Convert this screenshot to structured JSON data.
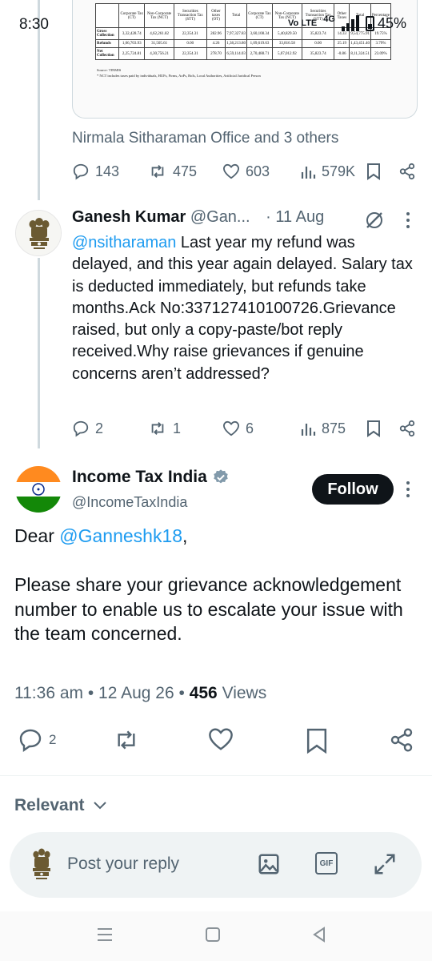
{
  "status_bar": {
    "time": "8:30",
    "network": "4G",
    "volte": "Vo LTE",
    "battery": "45%"
  },
  "media": {
    "table": {
      "headers": [
        "",
        "Corporate Tax (CT)",
        "Non-Corporate Tax (NCT)",
        "Securities Transaction Tax (STT)",
        "Other taxes (OT)",
        "Total",
        "Corporate Tax (CT)",
        "Non-Corporate Tax (NCT)",
        "Securities Transaction Tax (STT)",
        "Other Taxes",
        "Total",
        "Percentage"
      ],
      "rows": [
        [
          "Gross Collection",
          "3,32,428.74",
          "4,62,261.82",
          "22,354.31",
          "282.96",
          "7,97,327.83",
          "3,60,108.34",
          "5,40,829.50",
          "35,823.74",
          "14.33",
          "9,54,775.91",
          "19.75%"
        ],
        [
          "Refunds",
          "1,06,703.93",
          "31,505.61",
          "0.00",
          "4.26",
          "1,38,213.80",
          "1,09,619.63",
          "33,816.58",
          "0.00",
          "25.19",
          "1,43,451.40",
          "3.79%"
        ],
        [
          "Net Collection",
          "2,25,724.81",
          "4,30,756.21",
          "22,354.31",
          "278.70",
          "6,59,114.03",
          "2,70,488.71",
          "5,07,012.92",
          "35,823.74",
          "-0.86",
          "8,11,324.51",
          "23.09%"
        ]
      ]
    },
    "source": "Source: TINMIS",
    "note": "* NCT includes taxes paid by individuals, HUFs, Firms, AoPs, BoIs, Local Authorities, Artificial Juridical Person"
  },
  "top_tweet": {
    "tagged": "Nirmala Sitharaman Office and 3 others",
    "replies": "143",
    "reposts": "475",
    "likes": "603",
    "views": "579K"
  },
  "reply_tweet": {
    "name": "Ganesh Kumar",
    "handle": "@Gan...",
    "dot": "·",
    "date": "11 Aug",
    "mention": "@nsitharaman",
    "text": " Last year my refund was delayed, and this year again delayed. Salary tax is deducted immediately, but refunds take months.Ack No:337127410100726.Grievance raised, but only a copy-paste/bot reply received.Why raise grievances if genuine concerns aren’t addressed?",
    "replies": "2",
    "reposts": "1",
    "likes": "6",
    "views": "875"
  },
  "main_tweet": {
    "name": "Income Tax India",
    "handle": "@IncomeTaxIndia",
    "follow_label": "Follow",
    "text_prefix": "Dear ",
    "mention": "@Ganneshk18",
    "text_suffix": ",",
    "text_body": "Please share your grievance acknowledgement number to enable us to escalate your issue with the team concerned.",
    "time": "11:36 am",
    "sep": "•",
    "date": "12 Aug 26",
    "views_count": "456",
    "views_label": "Views",
    "replies": "2"
  },
  "sort": {
    "label": "Relevant"
  },
  "reply_bar": {
    "placeholder": "Post your reply",
    "gif_label": "GIF"
  },
  "colors": {
    "accent": "#1d9bf0",
    "text": "#0f1419",
    "muted": "#536471",
    "verified": "#829aab"
  }
}
